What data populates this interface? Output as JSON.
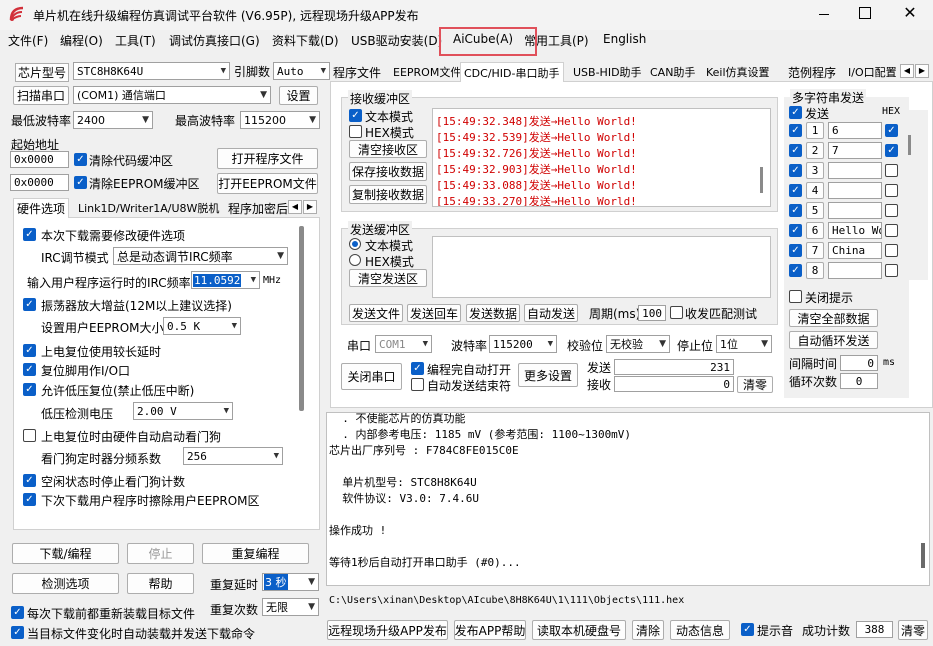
{
  "titlebar": {
    "title": "单片机在线升级编程仿真调试平台软件 (V6.95P), 远程现场升级APP发布"
  },
  "menu": [
    "文件(F)",
    "编程(O)",
    "工具(T)",
    "调试仿真接口(G)",
    "资料下载(D)",
    "USB驱动安装(D)",
    "AiCube(A)",
    "常用工具(P)",
    "English"
  ],
  "left": {
    "chip_label": "芯片型号",
    "chip_value": "STC8H8K64U",
    "pin_label": "引脚数",
    "pin_value": "Auto",
    "scan_btn": "扫描串口",
    "port_value": "(COM1) 通信端口",
    "settings_btn": "设置",
    "min_baud_label": "最低波特率",
    "min_baud": "2400",
    "max_baud_label": "最高波特率",
    "max_baud": "115200",
    "start_addr_label": "起始地址",
    "addr1": "0x0000",
    "clear_code": "清除代码缓冲区",
    "open_prog_btn": "打开程序文件",
    "addr2": "0x0000",
    "clear_eeprom": "清除EEPROM缓冲区",
    "open_eeprom_btn": "打开EEPROM文件",
    "tabs": [
      "硬件选项",
      "Link1D/Writer1A/U8W脱机",
      "程序加密后"
    ],
    "hw": {
      "opt1": "本次下载需要修改硬件选项",
      "irc_mode_label": "IRC调节模式",
      "irc_mode_value": "总是动态调节IRC频率",
      "irc_freq_label": "输入用户程序运行时的IRC频率",
      "irc_freq_value": "11.0592",
      "irc_unit": "MHz",
      "osc": "振荡器放大增益(12M以上建议选择)",
      "eeprom_label": "设置用户EEPROM大小",
      "eeprom_value": "0.5 K",
      "por_delay": "上电复位使用较长延时",
      "reset_io": "复位脚用作I/O口",
      "lvr": "允许低压复位(禁止低压中断)",
      "lvd_label": "低压检测电压",
      "lvd_value": "2.00 V",
      "wdt": "上电复位时由硬件自动启动看门狗",
      "wdt_div_label": "看门狗定时器分频系数",
      "wdt_div_value": "256",
      "idle_wdt": "空闲状态时停止看门狗计数",
      "erase_eeprom": "下次下载用户程序时擦除用户EEPROM区"
    },
    "download_btn": "下载/编程",
    "stop_btn": "停止",
    "reprog_btn": "重复编程",
    "check_btn": "检测选项",
    "help_btn": "帮助",
    "repeat_delay_label": "重复延时",
    "repeat_delay_value": "3 秒",
    "reload_each": "每次下载前都重新装载目标文件",
    "repeat_count_label": "重复次数",
    "repeat_count_value": "无限",
    "auto_send": "当目标文件变化时自动装载并发送下载命令"
  },
  "tabs": [
    "程序文件",
    "EEPROM文件",
    "CDC/HID-串口助手",
    "USB-HID助手",
    "CAN助手",
    "Keil仿真设置",
    "范例程序",
    "I/O口配置"
  ],
  "receive": {
    "title": "接收缓冲区",
    "text_mode": "文本模式",
    "hex_mode": "HEX模式",
    "clear_btn": "清空接收区",
    "save_btn": "保存接收数据",
    "copy_btn": "复制接收数据",
    "lines": [
      "[15:49:32.348]发送→Hello World!",
      "[15:49:32.539]发送→Hello World!",
      "[15:49:32.726]发送→Hello World!",
      "[15:49:32.903]发送→Hello World!",
      "[15:49:33.088]发送→Hello World!",
      "[15:49:33.270]发送→Hello World!"
    ]
  },
  "send": {
    "title": "发送缓冲区",
    "text_mode": "文本模式",
    "hex_mode": "HEX模式",
    "clear_btn": "清空发送区",
    "send_file_btn": "发送文件",
    "send_cr_btn": "发送回车",
    "send_data_btn": "发送数据",
    "auto_send_btn": "自动发送",
    "period_label": "周期(ms)",
    "period_value": "100",
    "match_test": "收发匹配测试"
  },
  "multi": {
    "title": "多字符串发送",
    "send_hdr": "发送",
    "hex_hdr": "HEX",
    "rows": [
      {
        "n": "1",
        "text": "6",
        "hex": true
      },
      {
        "n": "2",
        "text": "7",
        "hex": true
      },
      {
        "n": "3",
        "text": "",
        "hex": false
      },
      {
        "n": "4",
        "text": "",
        "hex": false
      },
      {
        "n": "5",
        "text": "",
        "hex": false
      },
      {
        "n": "6",
        "text": "Hello Wo:",
        "hex": false
      },
      {
        "n": "7",
        "text": "China",
        "hex": false
      },
      {
        "n": "8",
        "text": "",
        "hex": false
      }
    ],
    "close_tip": "关闭提示",
    "clear_all_btn": "清空全部数据",
    "auto_loop_btn": "自动循环发送",
    "interval_label": "间隔时间",
    "interval_value": "0",
    "interval_unit": "ms",
    "loop_label": "循环次数",
    "loop_value": "0"
  },
  "serial": {
    "port_label": "串口",
    "port_value": "COM1",
    "baud_label": "波特率",
    "baud_value": "115200",
    "parity_label": "校验位",
    "parity_value": "无校验",
    "stop_label": "停止位",
    "stop_value": "1位",
    "close_btn": "关闭串口",
    "auto_open": "编程完自动打开",
    "auto_send_end": "自动发送结束符",
    "more_btn": "更多设置",
    "sent_label": "发送",
    "sent_value": "231",
    "recv_label": "接收",
    "recv_value": "0",
    "clear_btn": "清零"
  },
  "log": {
    "lines": [
      "  . 不使能芯片的仿真功能",
      "  . 内部参考电压: 1185 mV (参考范围: 1100~1300mV)",
      "芯片出厂序列号 : F784C8FE015C0E",
      "",
      "  单片机型号: STC8H8K64U",
      "  软件协议: V3.0: 7.4.6U",
      "",
      "操作成功 !",
      "",
      "等待1秒后自动打开串口助手 (#0)..."
    ]
  },
  "path": "C:\\Users\\xinan\\Desktop\\AIcube\\8H8K64U\\1\\111\\Objects\\111.hex",
  "bottom": {
    "remote_btn": "远程现场升级APP发布",
    "help_btn": "发布APP帮助",
    "read_btn": "读取本机硬盘号",
    "clear_btn": "清除",
    "dyn_btn": "动态信息",
    "beep": "提示音",
    "count_label": "成功计数",
    "count_value": "388",
    "reset_btn": "清零"
  },
  "colors": {
    "highlight": "#e0505a",
    "checkbox": "#0a5fc8",
    "recv_text": "#d00000"
  }
}
